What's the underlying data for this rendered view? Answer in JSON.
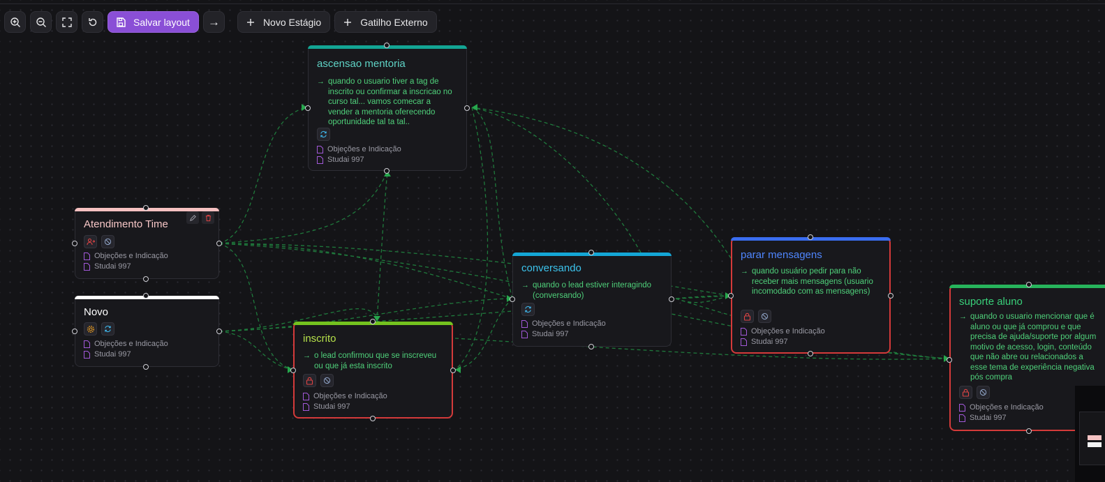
{
  "toolbar": {
    "zoom_in": "zoom-in-icon",
    "zoom_out": "zoom-out-icon",
    "fit_view": "fit-view-icon",
    "reset": "reset-icon",
    "save_layout_label": "Salvar layout",
    "arrow": "→",
    "new_stage_label": "Novo Estágio",
    "external_trigger_label": "Gatilho Externo"
  },
  "colors": {
    "accent": "#8a4fd6",
    "edge": "#1f7a3c",
    "trigger_text": "#4fd07a",
    "selected_border": "#d43a3a"
  },
  "nodes": {
    "ascensao": {
      "title": "ascensao mentoria",
      "title_color": "#5fd3c6",
      "bar_color": "#13a594",
      "trigger": "quando o usuario tiver a tag de inscrito ou confirmar a inscricao no curso tal... vamos comecar a vender a mentoria oferecendo oportunidade tal ta tal..",
      "docs": [
        "Objeções e Indicação",
        "Studai 997"
      ],
      "badges": [
        "sync-icon"
      ]
    },
    "atendimento": {
      "title": "Atendimento Time",
      "title_color": "#f7c7c7",
      "bar_color": "#f6c1c1",
      "docs": [
        "Objeções e Indicação",
        "Studai 997"
      ],
      "badges": [
        "user-assign-icon",
        "block-icon"
      ]
    },
    "novo": {
      "title": "Novo",
      "title_color": "#ffffff",
      "bar_color": "#ffffff",
      "docs": [
        "Objeções e Indicação",
        "Studai 997"
      ],
      "badges": [
        "gear-icon",
        "sync-icon"
      ]
    },
    "inscrito": {
      "title": "inscrito",
      "title_color": "#b6e14a",
      "bar_color": "#74c21f",
      "trigger": "o lead confirmou que se inscreveu ou que já esta inscrito",
      "docs": [
        "Objeções e Indicação",
        "Studai 997"
      ],
      "badges": [
        "lock-icon",
        "block-icon"
      ]
    },
    "conversando": {
      "title": "conversando",
      "title_color": "#3cc3ec",
      "bar_color": "#14a6d6",
      "trigger": "quando o lead estiver interagindo (conversando)",
      "docs": [
        "Objeções e Indicação",
        "Studai 997"
      ],
      "badges": [
        "sync-icon"
      ]
    },
    "parar": {
      "title": "parar mensagens",
      "title_color": "#4f86ff",
      "bar_color": "#3a6df0",
      "trigger": "quando usuário pedir para não receber mais mensagens (usuario incomodado com as mensagens)",
      "docs": [
        "Objeções e Indicação",
        "Studai 997"
      ],
      "badges": [
        "lock-icon",
        "block-icon"
      ]
    },
    "suporte": {
      "title": "suporte aluno",
      "title_color": "#39d07a",
      "bar_color": "#27b45c",
      "trigger": "quando o usuario mencionar que é aluno ou que já comprou e que precisa de ajuda/suporte por algum motivo de acesso, login, conteúdo que não abre ou relacionados a esse tema de experiência negativa pós compra",
      "docs": [
        "Objeções e Indicação",
        "Studai 997"
      ],
      "badges": [
        "lock-icon",
        "block-icon"
      ]
    }
  }
}
